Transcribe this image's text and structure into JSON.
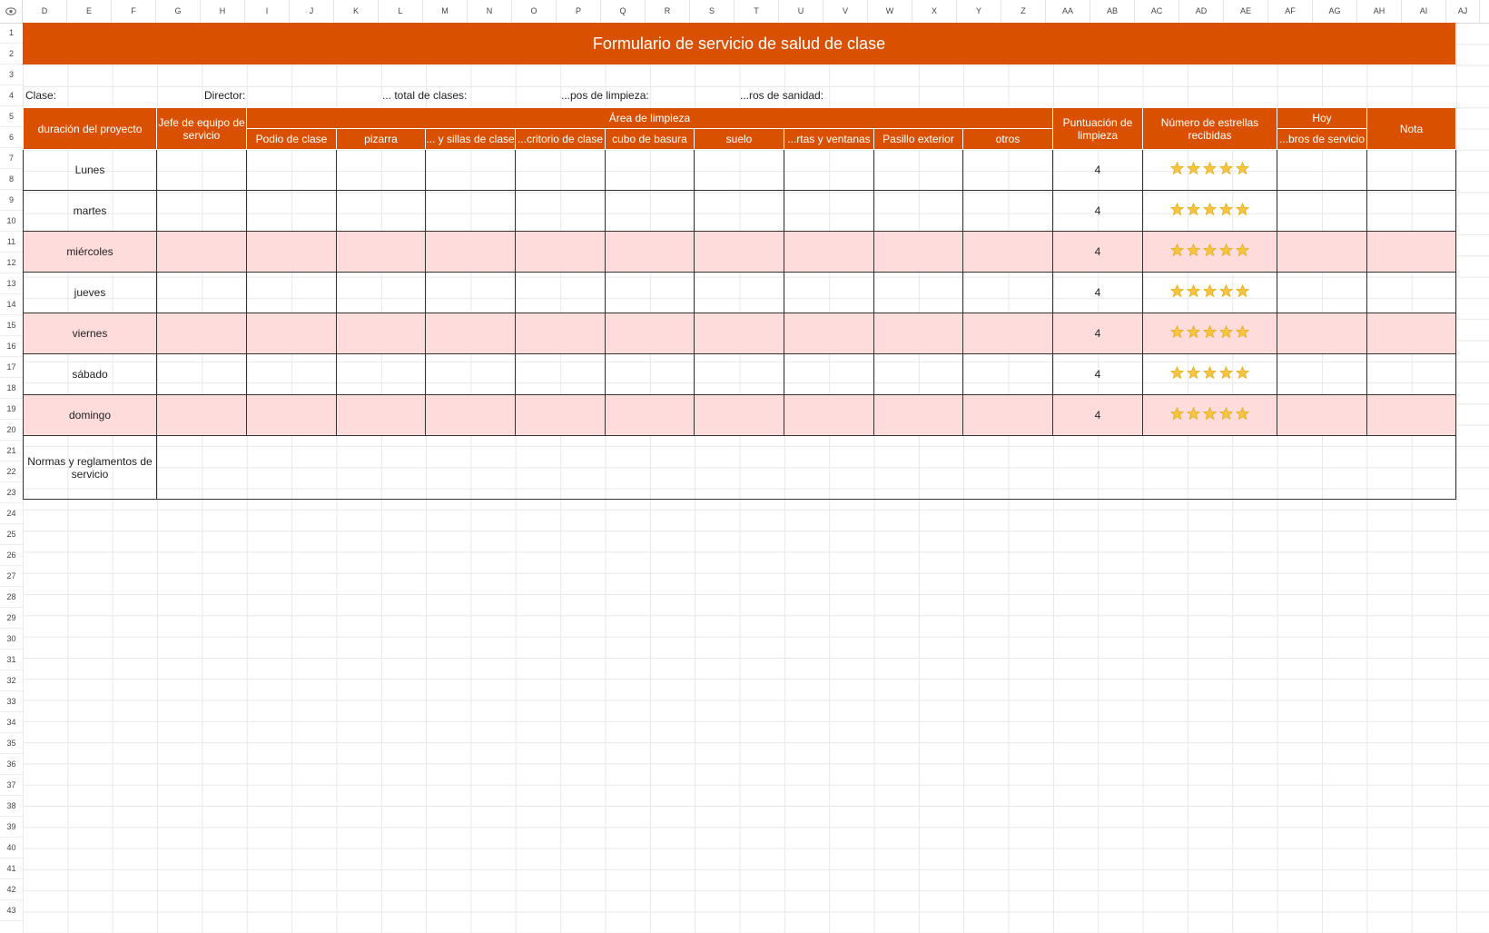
{
  "columns": [
    "D",
    "E",
    "F",
    "G",
    "H",
    "I",
    "J",
    "K",
    "L",
    "M",
    "N",
    "O",
    "P",
    "Q",
    "R",
    "S",
    "T",
    "U",
    "V",
    "W",
    "X",
    "Y",
    "Z",
    "AA",
    "AB",
    "AC",
    "AD",
    "AE",
    "AF",
    "AG",
    "AH",
    "AI",
    "AJ"
  ],
  "rows": [
    "1",
    "2",
    "3",
    "4",
    "5",
    "6",
    "7",
    "8",
    "9",
    "10",
    "11",
    "12",
    "13",
    "14",
    "15",
    "16",
    "17",
    "18",
    "19",
    "20",
    "21",
    "22",
    "23",
    "24",
    "25",
    "26",
    "27",
    "28",
    "29",
    "30",
    "31",
    "32",
    "33",
    "34",
    "35",
    "36",
    "37",
    "38",
    "39",
    "40",
    "41",
    "42",
    "43"
  ],
  "title": "Formulario de servicio de salud de clase",
  "info": {
    "clase": "Clase:",
    "director": "Director:",
    "total": "... total de clases:",
    "grupos": "...pos de limpieza:",
    "sanidad": "...ros de sanidad:"
  },
  "headers": {
    "duracion": "duración del proyecto",
    "jefe": "Jefe de equipo de servicio",
    "area": "Área de limpieza",
    "puntuacion": "Puntuación de limpieza",
    "estrellas": "Número de estrellas recibidas",
    "hoy": "Hoy",
    "miembros": "...bros de servicio",
    "nota": "Nota",
    "areas": [
      "Podio de clase",
      "pizarra",
      "... y sillas de clase",
      "...critorio de clase",
      "cubo de basura",
      "suelo",
      "...rtas y ventanas",
      "Pasillo exterior",
      "otros"
    ]
  },
  "days": [
    {
      "name": "Lunes",
      "score": "4",
      "stars": 5
    },
    {
      "name": "martes",
      "score": "4",
      "stars": 5
    },
    {
      "name": "miércoles",
      "score": "4",
      "stars": 5
    },
    {
      "name": "jueves",
      "score": "4",
      "stars": 5
    },
    {
      "name": "viernes",
      "score": "4",
      "stars": 5
    },
    {
      "name": "sábado",
      "score": "4",
      "stars": 5
    },
    {
      "name": "domingo",
      "score": "4",
      "stars": 5
    }
  ],
  "rules_label": "Normas y reglamentos de servicio",
  "colors": {
    "accent": "#d95100",
    "pink": "#ffdcdc",
    "star": "#f5c542"
  },
  "icons": {
    "corner": "eye-icon",
    "star": "star-icon"
  }
}
